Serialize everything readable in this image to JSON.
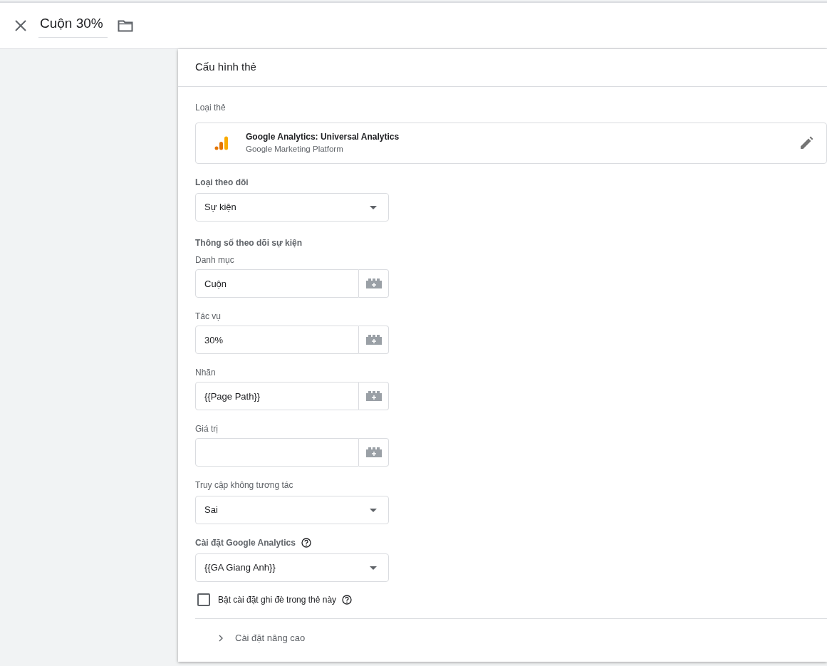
{
  "header": {
    "title": "Cuộn 30%"
  },
  "card": {
    "title": "Cấu hình thẻ",
    "tag_type_label": "Loại thẻ",
    "tag_type": {
      "name": "Google Analytics: Universal Analytics",
      "vendor": "Google Marketing Platform"
    },
    "fields": [
      {
        "kind": "select",
        "label": "Loại theo dõi",
        "strong": true,
        "value": "Sự kiện"
      },
      {
        "kind": "section",
        "label": "Thông số theo dõi sự kiện"
      },
      {
        "kind": "variable",
        "label": "Danh mục",
        "strong": false,
        "value": "Cuộn"
      },
      {
        "kind": "variable",
        "label": "Tác vụ",
        "strong": false,
        "value": "30%"
      },
      {
        "kind": "variable",
        "label": "Nhãn",
        "strong": false,
        "value": "{{Page Path}}"
      },
      {
        "kind": "variable",
        "label": "Giá trị",
        "strong": false
      },
      {
        "kind": "select",
        "label": "Truy cập không tương tác",
        "strong": false,
        "value": "Sai"
      },
      {
        "kind": "select",
        "label": "Cài đặt Google Analytics",
        "strong": true,
        "help": true,
        "value": "{{GA Giang Anh}}"
      },
      {
        "kind": "checkbox",
        "label": "Bật cài đặt ghi đè trong thẻ này",
        "checked": false,
        "help": true
      }
    ],
    "advanced": {
      "label": "Cài đặt nâng cao",
      "expanded": false
    }
  }
}
